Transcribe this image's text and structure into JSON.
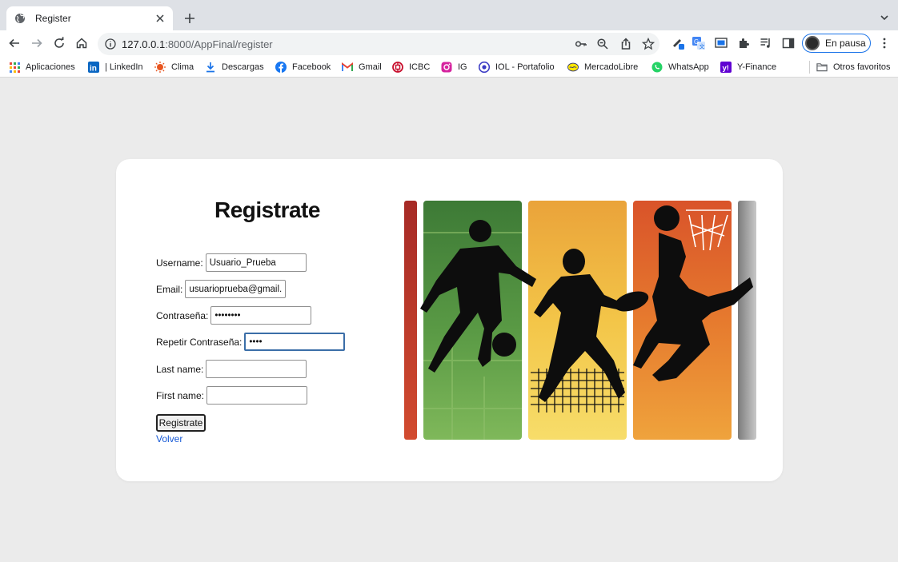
{
  "browser": {
    "tab_title": "Register",
    "url_host": "127.0.0.1",
    "url_path": ":8000/AppFinal/register",
    "profile_label": "En pausa",
    "bookmarks": [
      {
        "label": "Aplicaciones",
        "icon": "apps-grid-icon",
        "color": "#e8453c"
      },
      {
        "label": "| LinkedIn",
        "icon": "linkedin-icon",
        "color": "#0a66c2"
      },
      {
        "label": "Clima",
        "icon": "weather-sun-icon",
        "color": "#e8551f"
      },
      {
        "label": "Descargas",
        "icon": "download-icon",
        "color": "#1a73e8"
      },
      {
        "label": "Facebook",
        "icon": "facebook-icon",
        "color": "#1877f2"
      },
      {
        "label": "Gmail",
        "icon": "gmail-icon",
        "color": "#ea4335"
      },
      {
        "label": "ICBC",
        "icon": "icbc-icon",
        "color": "#c8102e"
      },
      {
        "label": "IG",
        "icon": "instagram-icon",
        "color": "#d6249f"
      },
      {
        "label": "IOL - Portafolio",
        "icon": "iol-icon",
        "color": "#3b3bc4"
      },
      {
        "label": "MercadoLibre",
        "icon": "mercadolibre-icon",
        "color": "#ffe600"
      },
      {
        "label": "WhatsApp",
        "icon": "whatsapp-icon",
        "color": "#25d366"
      },
      {
        "label": "Y-Finance",
        "icon": "yahoo-icon",
        "color": "#6001d2"
      }
    ],
    "other_bookmarks": "Otros favoritos"
  },
  "form": {
    "title": "Registrate",
    "fields": {
      "username": {
        "label": "Username:",
        "value": "Usuario_Prueba"
      },
      "email": {
        "label": "Email:",
        "value": "usuarioprueba@gmail.c"
      },
      "password1": {
        "label": "Contraseña:",
        "value": "••••••••"
      },
      "password2": {
        "label": "Repetir Contraseña:",
        "value": "••••"
      },
      "last_name": {
        "label": "Last name:",
        "value": ""
      },
      "first_name": {
        "label": "First name:",
        "value": ""
      }
    },
    "submit_label": "Registrate",
    "back_link": "Volver"
  },
  "colors": {
    "accent": "#1a73e8",
    "link": "#1558d6",
    "panel_red": "#c0392b",
    "panel_green": "#4a8a3e",
    "panel_yellow": "#f0b83a",
    "panel_orange": "#e5742b",
    "panel_gray": "#9a9a9a"
  }
}
